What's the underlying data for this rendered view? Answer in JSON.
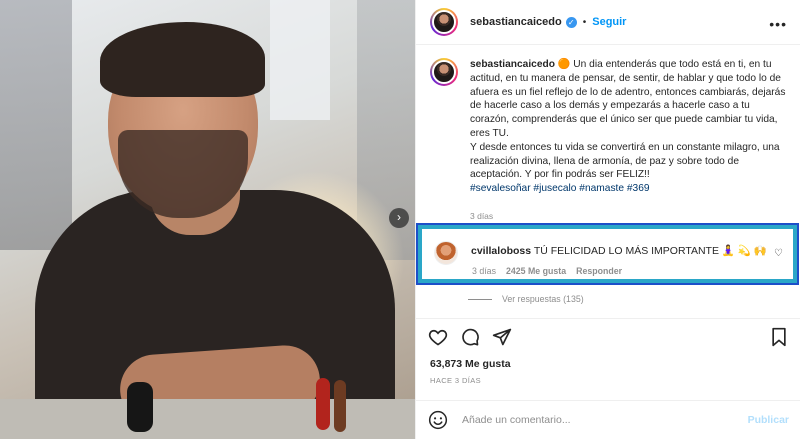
{
  "colors": {
    "accent_blue": "#0095f6",
    "highlight_outer": "#1d4fc9",
    "highlight_inner": "#2aa7c8",
    "muted_text": "#8e8e8e",
    "hashtag": "#00376b"
  },
  "header": {
    "username": "sebastiancaicedo",
    "separator": "•",
    "follow_label": "Seguir",
    "more_icon": "more-horizontal-icon"
  },
  "caption": {
    "username": "sebastiancaicedo",
    "text": "🟠 Un dia entenderás que todo está en ti, en tu actitud, en tu manera de pensar, de sentir, de hablar y que todo lo de afuera es un fiel reflejo de lo de adentro, entonces cambiarás, dejarás de hacerle caso a los demás y empezarás a hacerle caso a tu corazón, comprenderás que el único ser que puede cambiar tu vida, eres TU.\nY desde entonces tu vida se convertirá en un constante milagro, una realización divina, llena de armonía, de paz y sobre todo de aceptación. Y por fin podrás ser FELIZ!!",
    "hashtags": "#sevalesoñar #jusecalo #namaste #369",
    "time": "3 días"
  },
  "comment": {
    "username": "cvillaloboss",
    "text": "TÚ FELICIDAD LO MÁS IMPORTANTE 🧘‍♀️ 💫 🙌",
    "time": "3 días",
    "likes": "2425 Me gusta",
    "reply_label": "Responder"
  },
  "replies": {
    "label": "Ver respuestas (135)"
  },
  "actions": {
    "like_icon": "heart-icon",
    "comment_icon": "comment-icon",
    "share_icon": "share-icon",
    "save_icon": "bookmark-icon"
  },
  "likes": "63,873 Me gusta",
  "date": "HACE 3 DÍAS",
  "add_comment": {
    "placeholder": "Añade un comentario...",
    "publish_label": "Publicar",
    "emoji_icon": "emoji-icon"
  },
  "carousel": {
    "next_icon": "chevron-right-icon"
  }
}
